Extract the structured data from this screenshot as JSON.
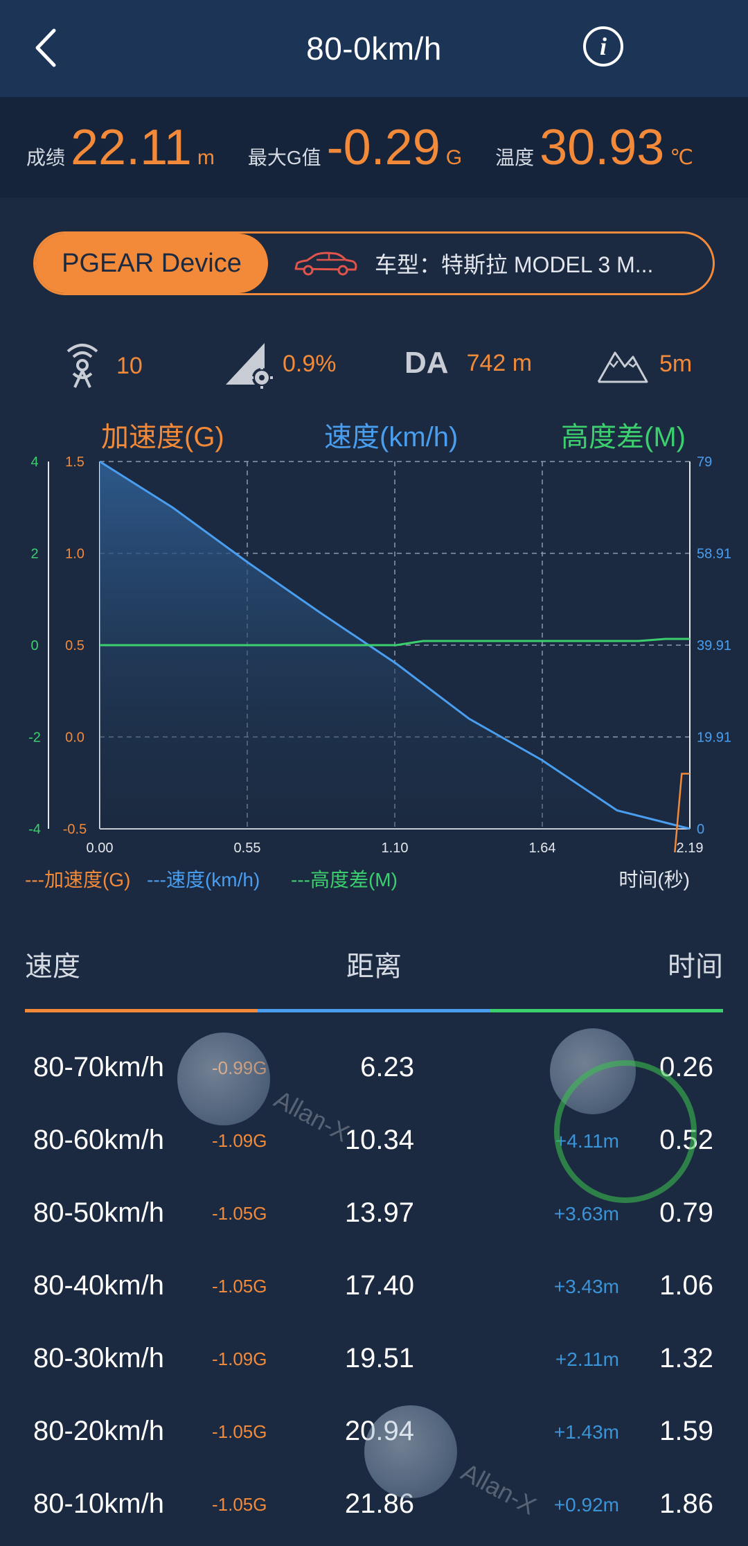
{
  "header": {
    "title": "80-0km/h"
  },
  "stats": [
    {
      "label": "成绩",
      "value": "22.11",
      "unit": "m"
    },
    {
      "label": "最大G值",
      "value": "-0.29",
      "unit": "G"
    },
    {
      "label": "温度",
      "value": "30.93",
      "unit": "℃"
    }
  ],
  "device": {
    "name": "PGEAR Device",
    "car_model": "车型：特斯拉 MODEL 3 M..."
  },
  "metrics": {
    "satellites": "10",
    "slope": "0.9%",
    "da_label": "DA",
    "da_value": "742 m",
    "altitude": "5m"
  },
  "chart_headings": {
    "left": "加速度(G)",
    "center": "速度(km/h)",
    "right": "高度差(M)"
  },
  "chart_data": {
    "type": "line",
    "x_label": "时间(秒)",
    "x_ticks": [
      "0.00",
      "0.55",
      "1.10",
      "1.64",
      "2.19"
    ],
    "x_range": [
      0,
      2.19
    ],
    "left_outer_ticks": [
      "4",
      "2",
      "0",
      "-2",
      "-4"
    ],
    "left_inner_ticks": [
      "1.5",
      "1.0",
      "0.5",
      "0.0",
      "-0.5"
    ],
    "right_ticks": [
      "79",
      "58.91",
      "39.91",
      "19.91",
      "0"
    ],
    "legend": [
      "---加速度(G)",
      "---速度(km/h)",
      "---高度差(M)"
    ],
    "series": [
      {
        "name": "速度(km/h)",
        "color": "#4a9ef0",
        "x": [
          0,
          0.27,
          0.55,
          0.82,
          1.1,
          1.37,
          1.64,
          1.92,
          2.19
        ],
        "y": [
          80,
          70,
          58,
          47,
          36,
          24,
          15,
          4,
          0
        ]
      },
      {
        "name": "高度差(M)",
        "color": "#3ccf6e",
        "x": [
          0,
          0.55,
          1.1,
          1.2,
          1.64,
          2.0,
          2.1,
          2.19
        ],
        "y": [
          0,
          0,
          0,
          0.1,
          0.1,
          0.1,
          0.15,
          0.15
        ]
      },
      {
        "name": "加速度(G)",
        "color": "#f28a3a",
        "x": [
          2.1,
          2.13,
          2.16,
          2.19
        ],
        "y": [
          -1.2,
          -0.7,
          -0.2,
          -0.2
        ]
      }
    ]
  },
  "table": {
    "headers": {
      "speed": "速度",
      "distance": "距离",
      "time": "时间"
    },
    "rows": [
      {
        "range": "80-70km/h",
        "g": "-0.99G",
        "distance": "6.23",
        "diff": "",
        "time": "0.26"
      },
      {
        "range": "80-60km/h",
        "g": "-1.09G",
        "distance": "10.34",
        "diff": "+4.11m",
        "time": "0.52"
      },
      {
        "range": "80-50km/h",
        "g": "-1.05G",
        "distance": "13.97",
        "diff": "+3.63m",
        "time": "0.79"
      },
      {
        "range": "80-40km/h",
        "g": "-1.05G",
        "distance": "17.40",
        "diff": "+3.43m",
        "time": "1.06"
      },
      {
        "range": "80-30km/h",
        "g": "-1.09G",
        "distance": "19.51",
        "diff": "+2.11m",
        "time": "1.32"
      },
      {
        "range": "80-20km/h",
        "g": "-1.05G",
        "distance": "20.94",
        "diff": "+1.43m",
        "time": "1.59"
      },
      {
        "range": "80-10km/h",
        "g": "-1.05G",
        "distance": "21.86",
        "diff": "+0.92m",
        "time": "1.86"
      }
    ]
  },
  "watermark": {
    "text": "Allan-X"
  },
  "colors": {
    "accent_orange": "#f28a3a",
    "speed_blue": "#4a9ef0",
    "altitude_green": "#3ccf6e",
    "background": "#1b2a40"
  }
}
